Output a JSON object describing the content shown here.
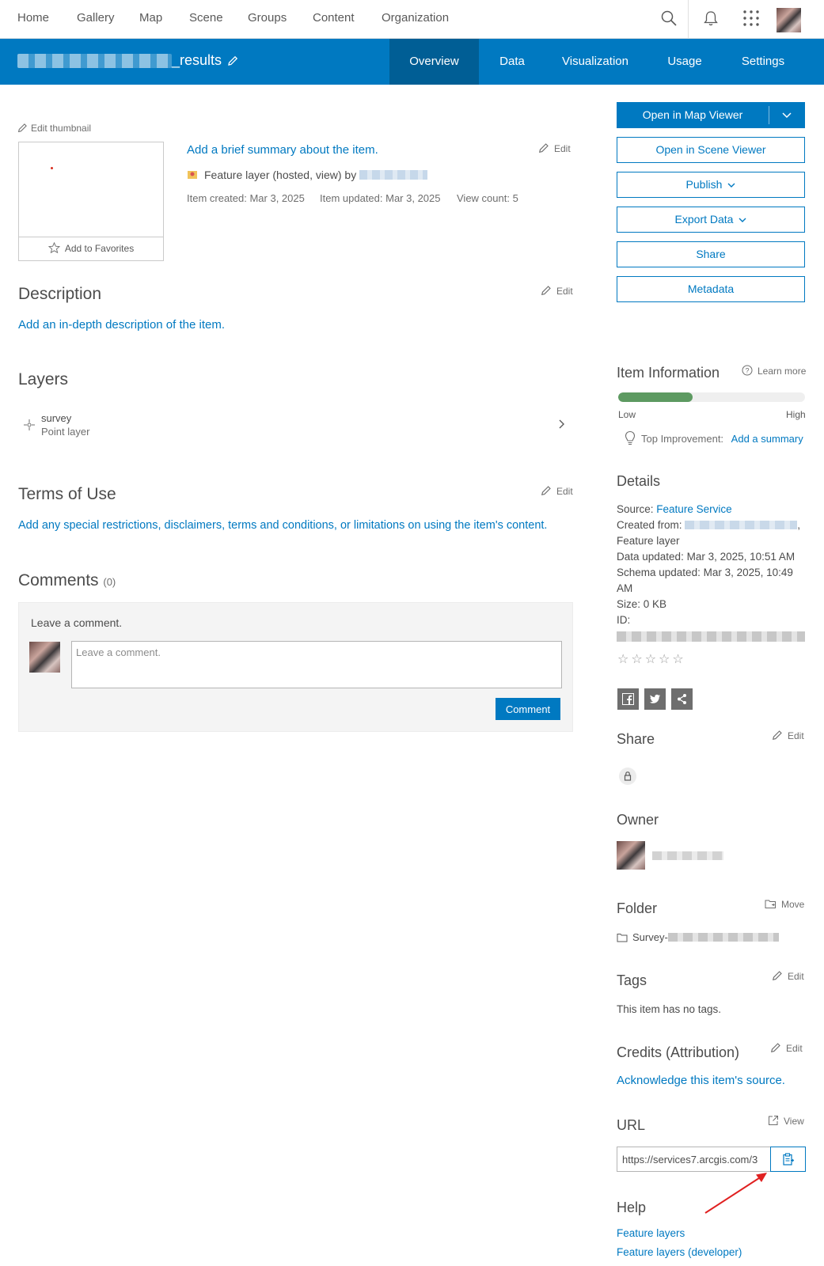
{
  "nav": {
    "items": [
      "Home",
      "Gallery",
      "Map",
      "Scene",
      "Groups",
      "Content",
      "Organization"
    ]
  },
  "header": {
    "title_suffix": "_results",
    "tabs": [
      "Overview",
      "Data",
      "Visualization",
      "Usage",
      "Settings"
    ],
    "active_tab": "Overview"
  },
  "overview": {
    "edit_thumbnail": "Edit thumbnail",
    "add_favorites": "Add to Favorites",
    "summary_placeholder": "Add a brief summary about the item.",
    "edit": "Edit",
    "item_type": "Feature layer (hosted, view) by",
    "created": "Item created: Mar 3, 2025",
    "updated": "Item updated: Mar 3, 2025",
    "view_count": "View count: 5"
  },
  "description": {
    "heading": "Description",
    "placeholder": "Add an in-depth description of the item."
  },
  "layers": {
    "heading": "Layers",
    "items": [
      {
        "name": "survey",
        "type": "Point layer"
      }
    ]
  },
  "terms": {
    "heading": "Terms of Use",
    "placeholder": "Add any special restrictions, disclaimers, terms and conditions, or limitations on using the item's content."
  },
  "comments": {
    "heading": "Comments",
    "count": "(0)",
    "label": "Leave a comment.",
    "input_placeholder": "Leave a comment.",
    "button": "Comment"
  },
  "actions": {
    "open_map_viewer": "Open in Map Viewer",
    "open_scene_viewer": "Open in Scene Viewer",
    "publish": "Publish",
    "export_data": "Export Data",
    "share": "Share",
    "metadata": "Metadata"
  },
  "item_info": {
    "heading": "Item Information",
    "learn_more": "Learn more",
    "score_fraction": 0.4,
    "low": "Low",
    "high": "High",
    "top_improvement_label": "Top Improvement:",
    "top_improvement_link": "Add a summary"
  },
  "details": {
    "heading": "Details",
    "source_label": "Source:",
    "source_value": "Feature Service",
    "created_from_label": "Created from:",
    "created_from_suffix": ",",
    "created_from_type": "Feature layer",
    "data_updated": "Data updated: Mar 3, 2025, 10:51 AM",
    "schema_updated_1": "Schema updated: Mar 3, 2025, 10:49",
    "schema_updated_2": "AM",
    "size": "Size: 0 KB",
    "id_label": "ID:",
    "stars": "☆☆☆☆☆"
  },
  "share": {
    "heading": "Share",
    "edit": "Edit"
  },
  "owner": {
    "heading": "Owner"
  },
  "folder": {
    "heading": "Folder",
    "move": "Move",
    "name_prefix": "Survey-"
  },
  "tags": {
    "heading": "Tags",
    "edit": "Edit",
    "empty": "This item has no tags."
  },
  "credits": {
    "heading": "Credits (Attribution)",
    "edit": "Edit",
    "link": "Acknowledge this item's source."
  },
  "url": {
    "heading": "URL",
    "view": "View",
    "value": "https://services7.arcgis.com/3"
  },
  "help": {
    "heading": "Help",
    "links": [
      "Feature layers",
      "Feature layers (developer)"
    ]
  },
  "colors": {
    "brand": "#0079c1",
    "brand_dark": "#005e95",
    "score_fill": "#5d9a61",
    "annotation_arrow": "#e02020"
  }
}
